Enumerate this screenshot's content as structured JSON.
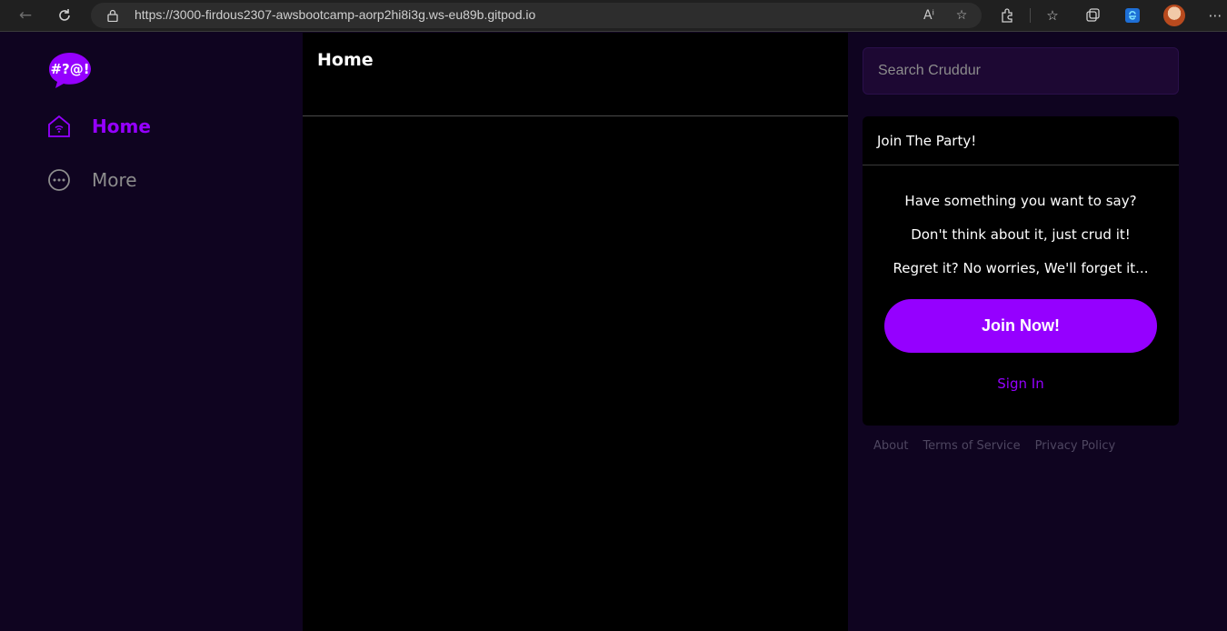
{
  "browser": {
    "url": "https://3000-firdous2307-awsbootcamp-aorp2hi8i3g.ws-eu89b.gitpod.io",
    "icons": {
      "back": "arrow-left-icon",
      "refresh": "refresh-icon",
      "lock": "lock-icon",
      "read_aloud": "read-aloud-icon",
      "favorite_add": "star-add-icon",
      "extensions": "puzzle-icon",
      "favorites": "favorites-icon",
      "collections": "collections-icon",
      "edge": "edge-icon",
      "profile": "avatar",
      "menu": "more-horizontal-icon"
    }
  },
  "app": {
    "logo_text": "#?@!",
    "nav": [
      {
        "label": "Home",
        "icon": "home-icon",
        "active": true
      },
      {
        "label": "More",
        "icon": "more-circle-icon",
        "active": false
      }
    ],
    "feed": {
      "title": "Home"
    },
    "search": {
      "placeholder": "Search Cruddur"
    },
    "join_card": {
      "title": "Join The Party!",
      "lines": [
        "Have something you want to say?",
        "Don't think about it, just crud it!",
        "Regret it? No worries, We'll forget it..."
      ],
      "join_button": "Join Now!",
      "sign_in": "Sign In"
    },
    "footer": [
      "About",
      "Terms of Service",
      "Privacy Policy"
    ],
    "colors": {
      "accent": "#9500ff",
      "background": "#0f0420",
      "feed_background": "#000000",
      "search_background": "#1d0833"
    }
  }
}
